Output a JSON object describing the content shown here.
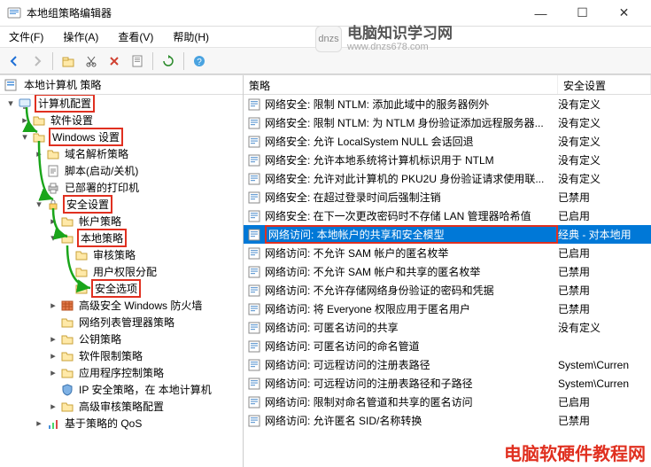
{
  "window": {
    "title": "本地组策略编辑器",
    "min": "—",
    "max": "☐",
    "close": "✕"
  },
  "menu": {
    "file": "文件(F)",
    "action": "操作(A)",
    "view": "查看(V)",
    "help": "帮助(H)"
  },
  "logo": {
    "abbr": "dnzs",
    "name": "电脑知识学习网",
    "url": "www.dnzs678.com"
  },
  "tree": {
    "root": "本地计算机 策略",
    "computer_cfg": "计算机配置",
    "software_settings": "软件设置",
    "windows_settings": "Windows 设置",
    "dns_policy": "域名解析策略",
    "scripts": "脚本(启动/关机)",
    "deployed_printers": "已部署的打印机",
    "security_settings": "安全设置",
    "account_policy": "帐户策略",
    "local_policy": "本地策略",
    "audit_policy": "审核策略",
    "user_rights": "用户权限分配",
    "security_options": "安全选项",
    "windows_firewall": "高级安全 Windows 防火墙",
    "netlist_mgr": "网络列表管理器策略",
    "public_key": "公钥策略",
    "software_restrict": "软件限制策略",
    "app_control": "应用程序控制策略",
    "ip_sec": "IP 安全策略，在 本地计算机",
    "adv_audit_cfg": "高级审核策略配置",
    "policy_qos": "基于策略的 QoS"
  },
  "list": {
    "hdr_policy": "策略",
    "hdr_setting": "安全设置",
    "rows": [
      {
        "label": "网络安全: 限制 NTLM: 添加此域中的服务器例外",
        "setting": "没有定义"
      },
      {
        "label": "网络安全: 限制 NTLM: 为 NTLM 身份验证添加远程服务器...",
        "setting": "没有定义"
      },
      {
        "label": "网络安全: 允许 LocalSystem NULL 会话回退",
        "setting": "没有定义"
      },
      {
        "label": "网络安全: 允许本地系统将计算机标识用于 NTLM",
        "setting": "没有定义"
      },
      {
        "label": "网络安全: 允许对此计算机的 PKU2U 身份验证请求使用联...",
        "setting": "没有定义"
      },
      {
        "label": "网络安全: 在超过登录时间后强制注销",
        "setting": "已禁用"
      },
      {
        "label": "网络安全: 在下一次更改密码时不存储 LAN 管理器哈希值",
        "setting": "已启用"
      },
      {
        "label": "网络访问: 本地帐户的共享和安全模型",
        "setting": "经典 - 对本地用",
        "selected": true,
        "highlight": true
      },
      {
        "label": "网络访问: 不允许 SAM 帐户的匿名枚举",
        "setting": "已启用"
      },
      {
        "label": "网络访问: 不允许 SAM 帐户和共享的匿名枚举",
        "setting": "已禁用"
      },
      {
        "label": "网络访问: 不允许存储网络身份验证的密码和凭据",
        "setting": "已禁用"
      },
      {
        "label": "网络访问: 将 Everyone 权限应用于匿名用户",
        "setting": "已禁用"
      },
      {
        "label": "网络访问: 可匿名访问的共享",
        "setting": "没有定义"
      },
      {
        "label": "网络访问: 可匿名访问的命名管道",
        "setting": ""
      },
      {
        "label": "网络访问: 可远程访问的注册表路径",
        "setting": "System\\Curren"
      },
      {
        "label": "网络访问: 可远程访问的注册表路径和子路径",
        "setting": "System\\Curren"
      },
      {
        "label": "网络访问: 限制对命名管道和共享的匿名访问",
        "setting": "已启用"
      },
      {
        "label": "网络访问: 允许匿名 SID/名称转换",
        "setting": "已禁用"
      }
    ]
  },
  "watermark": "电脑软硬件教程网"
}
